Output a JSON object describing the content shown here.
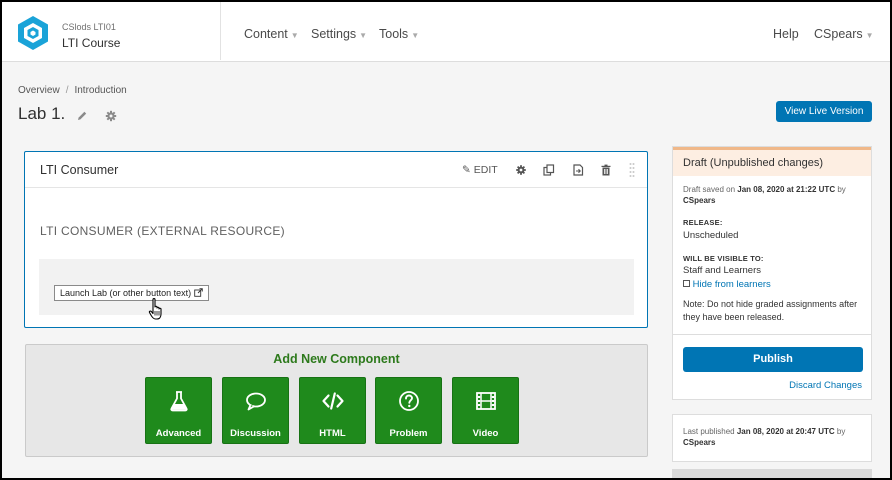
{
  "header": {
    "course_org": "CSlods  LTI01",
    "course_title": "LTI Course",
    "nav": [
      "Content",
      "Settings",
      "Tools"
    ],
    "help": "Help",
    "user": "CSpears"
  },
  "breadcrumb": [
    "Overview",
    "Introduction"
  ],
  "unit": {
    "title": "Lab 1.",
    "view_live_label": "View Live Version"
  },
  "xblock": {
    "name": "LTI Consumer",
    "edit_label": "EDIT",
    "type_heading": "LTI CONSUMER (EXTERNAL RESOURCE)",
    "launch_label": "Launch Lab (or other button text)"
  },
  "add_component": {
    "title": "Add New Component",
    "buttons": [
      {
        "label": "Advanced",
        "icon": "flask-icon"
      },
      {
        "label": "Discussion",
        "icon": "comment-icon"
      },
      {
        "label": "HTML",
        "icon": "code-icon"
      },
      {
        "label": "Problem",
        "icon": "question-circle-icon"
      },
      {
        "label": "Video",
        "icon": "film-icon"
      }
    ]
  },
  "sidebar": {
    "status_title": "Draft (Unpublished changes)",
    "saved_prefix": "Draft saved on",
    "saved_date": "Jan 08, 2020 at 21:22 UTC",
    "saved_by_word": "by",
    "saved_by": "CSpears",
    "release_label": "RELEASE:",
    "release_value": "Unscheduled",
    "visible_label": "WILL BE VISIBLE TO:",
    "visible_value": "Staff and Learners",
    "hide_label": "Hide from learners",
    "note": "Note: Do not hide graded assignments after they have been released.",
    "publish_label": "Publish",
    "discard_label": "Discard Changes",
    "last_published_prefix": "Last published",
    "last_published_date": "Jan 08, 2020 at 20:47 UTC",
    "last_published_by_word": "by",
    "last_published_by": "CSpears"
  },
  "colors": {
    "primary": "#0075b4",
    "component_green": "#1f8a1c",
    "draft_bg": "#fdeee2"
  }
}
